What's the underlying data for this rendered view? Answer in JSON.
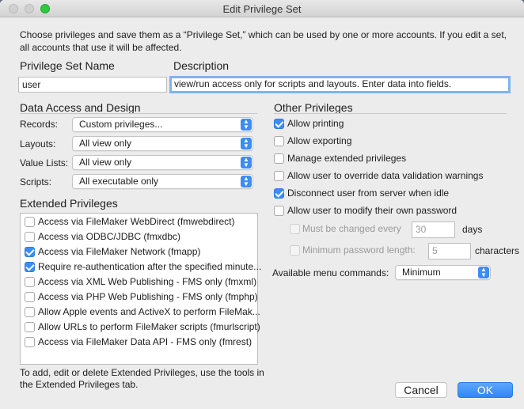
{
  "window": {
    "title": "Edit Privilege Set"
  },
  "intro": "Choose privileges and save them as a “Privilege Set,” which can be used by one or more accounts. If you edit a set, all accounts that use it will be affected.",
  "name": {
    "label": "Privilege Set Name",
    "value": "user"
  },
  "description": {
    "label": "Description",
    "value": "view/run access only for scripts and layouts. Enter data into fields."
  },
  "data_access": {
    "heading": "Data Access and Design",
    "records": {
      "label": "Records:",
      "value": "Custom privileges..."
    },
    "layouts": {
      "label": "Layouts:",
      "value": "All view only"
    },
    "value_lists": {
      "label": "Value Lists:",
      "value": "All view only"
    },
    "scripts": {
      "label": "Scripts:",
      "value": "All executable only"
    }
  },
  "extended": {
    "heading": "Extended Privileges",
    "items": [
      {
        "label": "Access via FileMaker WebDirect (fmwebdirect)",
        "checked": false
      },
      {
        "label": "Access via ODBC/JDBC (fmxdbc)",
        "checked": false
      },
      {
        "label": "Access via FileMaker Network (fmapp)",
        "checked": true
      },
      {
        "label": "Require re-authentication after the specified minute...",
        "checked": true
      },
      {
        "label": "Access via XML Web Publishing - FMS only (fmxml)",
        "checked": false
      },
      {
        "label": "Access via PHP Web Publishing - FMS only (fmphp)",
        "checked": false
      },
      {
        "label": "Allow Apple events and ActiveX to perform FileMak...",
        "checked": false
      },
      {
        "label": "Allow URLs to perform FileMaker scripts (fmurlscript)",
        "checked": false
      },
      {
        "label": "Access via FileMaker Data API - FMS only (fmrest)",
        "checked": false
      }
    ],
    "footnote": "To add, edit or delete Extended Privileges, use the tools in the Extended Privileges tab."
  },
  "other": {
    "heading": "Other Privileges",
    "allow_printing": {
      "label": "Allow printing",
      "checked": true
    },
    "allow_exporting": {
      "label": "Allow exporting",
      "checked": false
    },
    "manage_extended": {
      "label": "Manage extended privileges",
      "checked": false
    },
    "override_validation": {
      "label": "Allow user to override data validation warnings",
      "checked": false
    },
    "disconnect_idle": {
      "label": "Disconnect user from server when idle",
      "checked": true
    },
    "modify_password": {
      "label": "Allow user to modify their own password",
      "checked": false
    },
    "must_change": {
      "label": "Must be changed every",
      "value": "30",
      "unit": "days"
    },
    "min_length": {
      "label": "Minimum password length:",
      "value": "5",
      "unit": "characters"
    },
    "menu_commands": {
      "label": "Available menu commands:",
      "value": "Minimum"
    }
  },
  "buttons": {
    "cancel": "Cancel",
    "ok": "OK"
  },
  "colors": {
    "accent": "#3c8cf5",
    "background": "#ececec"
  }
}
